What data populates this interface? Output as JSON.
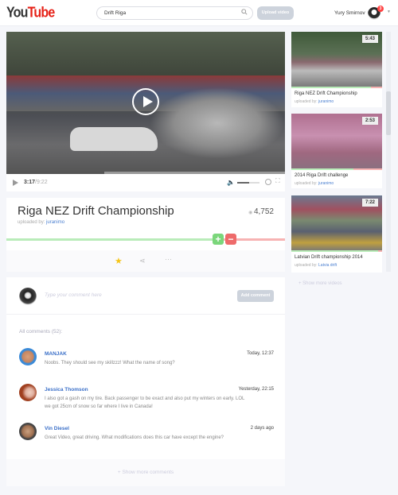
{
  "header": {
    "logo_you": "You",
    "logo_tube": "Tube",
    "search_value": "Drift Riga",
    "upload_label": "Upload video",
    "user_name": "Yury Smirnov",
    "notification_count": "3"
  },
  "player": {
    "current_time": "3:17",
    "duration": "/9:22",
    "progress_percent": 35,
    "volume_percent": 55
  },
  "video": {
    "title": "Riga NEZ Drift Championship",
    "uploaded_by_label": "uploaded by:",
    "uploader": "juranimo",
    "views": "4,752",
    "like_ratio_percent": 78,
    "like_label": "+",
    "dislike_label": "−"
  },
  "comments": {
    "placeholder": "Type your comment here",
    "add_label": "Add comment",
    "all_label": "All comments (52):",
    "show_more": "Show more comments",
    "items": [
      {
        "name": "MANJAK",
        "date": "Today, 12:37",
        "text": "Noobs. They should see my skillzzz! What the name of song?"
      },
      {
        "name": "Jessica Thomson",
        "date": "Yesterday, 22:15",
        "text": "I also got a gash on my tire. Back passenger to be exact and also put my winters on early. LOL we got 25cm of snow so far where I live in Canada!"
      },
      {
        "name": "Vin Diesel",
        "date": "2 days ago",
        "text": "Great Video, great driving. What modifications does this car have except the engine?"
      }
    ]
  },
  "sidebar": {
    "show_more": "Show more videos",
    "items": [
      {
        "title": "Riga NEZ Drift Championship",
        "uploaded_by_label": "uploaded by:",
        "uploader": "juranimo",
        "duration": "5:43",
        "like_ratio_percent": 88
      },
      {
        "title": "2014 Riga Drift challenge",
        "uploaded_by_label": "uploaded by:",
        "uploader": "juranimo",
        "duration": "2:53",
        "like_ratio_percent": 68
      },
      {
        "title": "Latvian Drift championship 2014",
        "uploaded_by_label": "uploaded by:",
        "uploader": "Latvia drift",
        "duration": "7:22",
        "like_ratio_percent": 96
      }
    ]
  },
  "colors": {
    "like": "#b9ecb9",
    "dislike": "#f7b3b3",
    "like_button": "#7bd67b",
    "dislike_button": "#ee6b6b",
    "link": "#4a7fd0",
    "star": "#f5c518"
  }
}
